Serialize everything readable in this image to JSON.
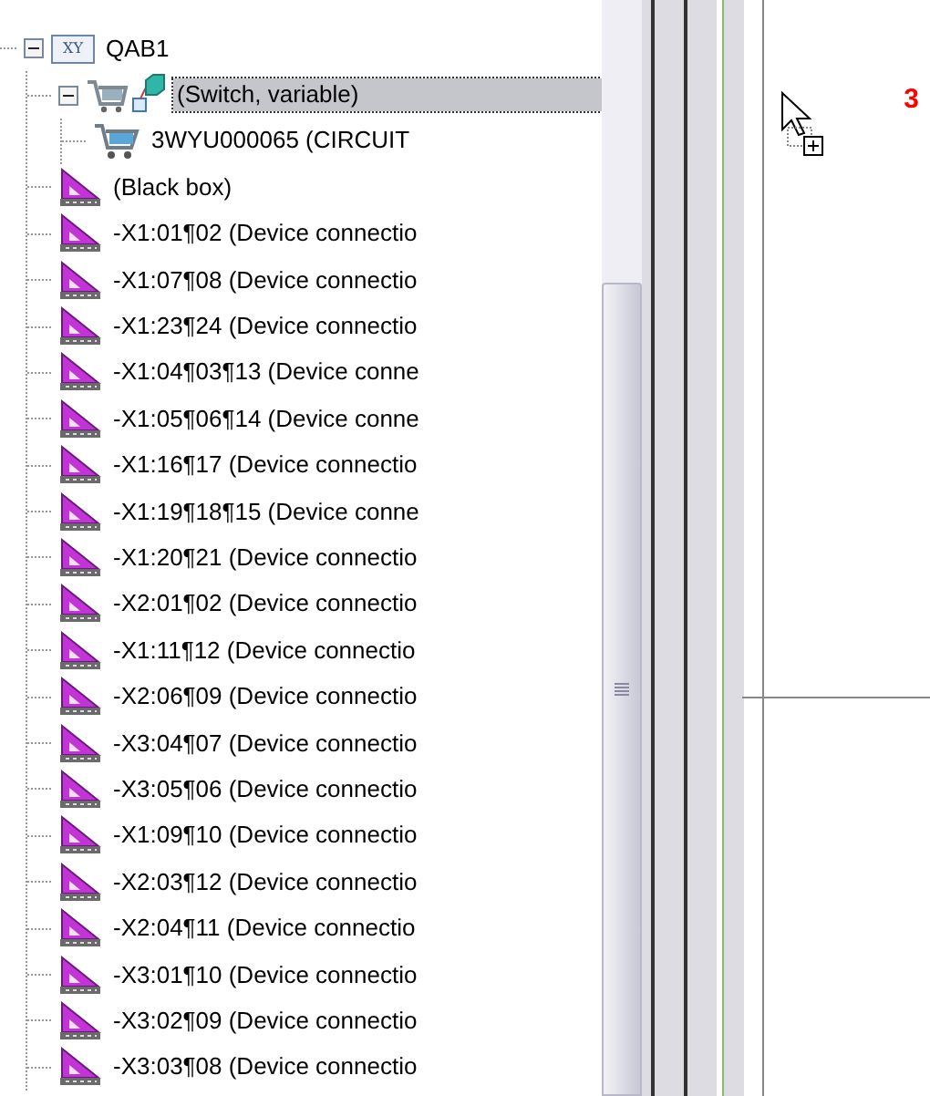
{
  "tree": [
    {
      "label": "QAB1",
      "kind": "xy",
      "icon_text": "XY",
      "selected": false,
      "expanded": true,
      "children": [
        {
          "label": "(Switch, variable)",
          "kind": "switch",
          "selected": true,
          "expanded": true,
          "children": [
            {
              "label": "3WYU000065 (CIRCUIT",
              "kind": "cart",
              "selected": false
            }
          ]
        },
        {
          "label": "(Black box)",
          "kind": "device",
          "selected": false
        },
        {
          "label": "-X1:01¶02 (Device connectio",
          "kind": "device",
          "selected": false
        },
        {
          "label": "-X1:07¶08 (Device connectio",
          "kind": "device",
          "selected": false
        },
        {
          "label": "-X1:23¶24 (Device connectio",
          "kind": "device",
          "selected": false
        },
        {
          "label": "-X1:04¶03¶13 (Device conne",
          "kind": "device",
          "selected": false
        },
        {
          "label": "-X1:05¶06¶14 (Device conne",
          "kind": "device",
          "selected": false
        },
        {
          "label": "-X1:16¶17 (Device connectio",
          "kind": "device",
          "selected": false
        },
        {
          "label": "-X1:19¶18¶15 (Device conne",
          "kind": "device",
          "selected": false
        },
        {
          "label": "-X1:20¶21 (Device connectio",
          "kind": "device",
          "selected": false
        },
        {
          "label": "-X2:01¶02 (Device connectio",
          "kind": "device",
          "selected": false
        },
        {
          "label": "-X1:11¶12 (Device connectio",
          "kind": "device",
          "selected": false
        },
        {
          "label": "-X2:06¶09 (Device connectio",
          "kind": "device",
          "selected": false
        },
        {
          "label": "-X3:04¶07 (Device connectio",
          "kind": "device",
          "selected": false
        },
        {
          "label": "-X3:05¶06 (Device connectio",
          "kind": "device",
          "selected": false
        },
        {
          "label": "-X1:09¶10 (Device connectio",
          "kind": "device",
          "selected": false
        },
        {
          "label": "-X2:03¶12 (Device connectio",
          "kind": "device",
          "selected": false
        },
        {
          "label": "-X2:04¶11 (Device connectio",
          "kind": "device",
          "selected": false
        },
        {
          "label": "-X3:01¶10 (Device connectio",
          "kind": "device",
          "selected": false
        },
        {
          "label": "-X3:02¶09 (Device connectio",
          "kind": "device",
          "selected": false
        },
        {
          "label": "-X3:03¶08 (Device connectio",
          "kind": "device",
          "selected": false
        }
      ]
    }
  ],
  "canvas": {
    "marker": "3"
  }
}
